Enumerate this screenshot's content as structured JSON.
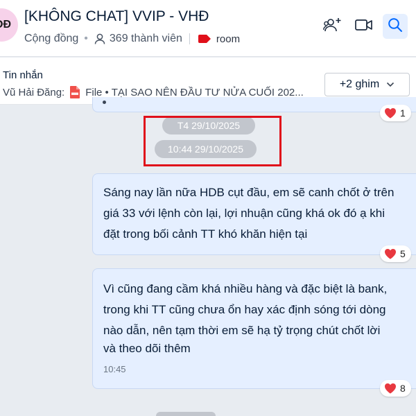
{
  "header": {
    "avatar_text": "ĐĐ",
    "title": "[KHÔNG CHAT] VVIP - VHĐ",
    "community_label": "Cộng đồng",
    "member_count": "369 thành viên",
    "tag_label": "room",
    "tag_color": "#e0101a",
    "icons": [
      "add-member-icon",
      "video-call-icon",
      "search-icon"
    ]
  },
  "pinned": {
    "title": "Tin nhắn",
    "sender": "Vũ Hải Đăng:",
    "file_label": "File • TẠI SAO NÊN ĐẦU TƯ NỬA CUỐI 202...",
    "more_label": "+2 ghim"
  },
  "chat": {
    "prev_reaction_count": "1",
    "date_stamp": "T4 29/10/2025",
    "time_stamp": "10:44 29/10/2025",
    "messages": [
      {
        "lines": [
          "Sáng nay lần nữa HDB cụt đầu, em sẽ canh chốt ở trên",
          "giá 33 với lệnh còn lại, lợi nhuận cũng khá ok đó ạ khi",
          "đặt trong bối cảnh TT khó khăn hiện tại"
        ],
        "reaction_count": "5"
      },
      {
        "lines": [
          "Vì cũng đang cầm khá nhiều hàng và đặc biệt là bank,",
          "trong khi TT cũng chưa ổn hay xác định sóng tới dòng",
          "nào dẫn, nên tạm thời em sẽ hạ tỷ trọng chút chốt lời",
          "và theo dõi thêm"
        ],
        "time": "10:45",
        "reaction_count": "8"
      }
    ]
  },
  "colors": {
    "bubble": "#e5efff",
    "accent": "#0068ff",
    "highlight_box": "#e0101a",
    "heart": "#e8383f"
  }
}
